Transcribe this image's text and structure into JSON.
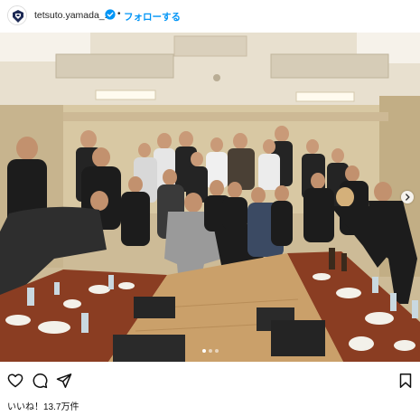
{
  "post": {
    "username": "tetsuto.yamada_1",
    "separator": "•",
    "follow_label": "フォローする",
    "avatar_icon": "team-logo-icon",
    "verified_icon": "verified-badge-icon",
    "verified_color": "#0095f6"
  },
  "media": {
    "description_icon": "group-photo-image",
    "carousel": {
      "total": 3,
      "current": 1
    },
    "next_icon": "chevron-right-icon"
  },
  "actions": {
    "like_icon": "heart-icon",
    "comment_icon": "comment-icon",
    "share_icon": "send-icon",
    "save_icon": "bookmark-icon"
  },
  "likes_text": "いいね！13.7万件"
}
